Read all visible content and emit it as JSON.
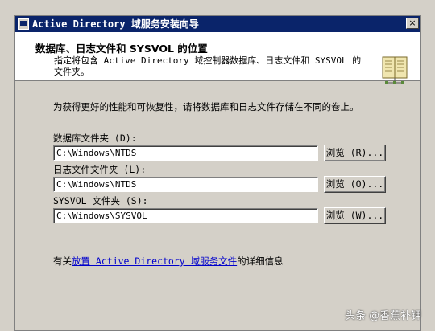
{
  "window": {
    "title": "Active Directory 域服务安装向导",
    "close_label": "×"
  },
  "header": {
    "title": "数据库、日志文件和 SYSVOL 的位置",
    "description": "指定将包含 Active Directory 域控制器数据库、日志文件和 SYSVOL 的文件夹。"
  },
  "content": {
    "intro": "为获得更好的性能和可恢复性，请将数据库和日志文件存储在不同的卷上。",
    "fields": [
      {
        "label": "数据库文件夹 (D):",
        "value": "C:\\Windows\\NTDS",
        "button": "浏览 (R)..."
      },
      {
        "label": "日志文件文件夹 (L):",
        "value": "C:\\Windows\\NTDS",
        "button": "浏览 (O)..."
      },
      {
        "label": "SYSVOL 文件夹 (S):",
        "value": "C:\\Windows\\SYSVOL",
        "button": "浏览 (W)..."
      }
    ],
    "more_info": {
      "prefix": "有关",
      "link": "放置 Active Directory 域服务文件",
      "suffix": "的详细信息"
    }
  },
  "watermark": "头条 @香蕉补钾",
  "icons": {
    "window": "app-icon",
    "header": "book-icon"
  },
  "colors": {
    "titlebar": "#0a246a",
    "dialog": "#d4d0c8",
    "link": "#0000cc"
  }
}
